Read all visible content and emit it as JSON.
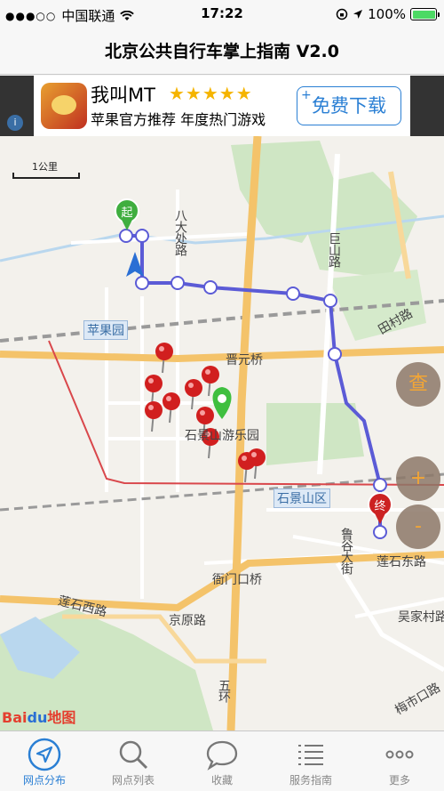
{
  "status_bar": {
    "carrier": "中国联通",
    "time": "17:22",
    "battery": "100%",
    "battery_level": 1.0
  },
  "nav": {
    "title": "北京公共自行车掌上指南 V2.0"
  },
  "ad": {
    "title": "我叫MT",
    "stars": "★★★★★",
    "rating": 5,
    "subtitle": "苹果官方推荐 年度热门游戏",
    "download_label": "免费下载"
  },
  "map": {
    "scale_label": "1公里",
    "start_marker": "起",
    "end_marker": "终",
    "query_button": "查",
    "zoom_in_button": "+",
    "zoom_out_button": "-",
    "labels": {
      "badachu": "八大处路",
      "jushan": "巨山路",
      "tianchun": "田村路",
      "pingguoyuan": "苹果园",
      "jinyuanqiao": "晋元桥",
      "youleyuan": "石景山游乐园",
      "shijingshan": "石景山区",
      "luguda": "鲁谷大街",
      "lianshidong": "莲石东路",
      "lianshixi": "莲石西路",
      "yamenkou": "衙门口桥",
      "jingyuan": "京原路",
      "wujiacun": "吴家村路",
      "wuhuan": "五环",
      "meishi": "梅市口路"
    },
    "brand": {
      "bai": "Bai",
      "du": "du",
      "suffix": "地图"
    }
  },
  "tabs": [
    {
      "label": "网点分布",
      "icon": "location-arrow-icon",
      "active": true
    },
    {
      "label": "网点列表",
      "icon": "search-icon",
      "active": false
    },
    {
      "label": "收藏",
      "icon": "chat-bubble-icon",
      "active": false
    },
    {
      "label": "服务指南",
      "icon": "list-icon",
      "active": false
    },
    {
      "label": "更多",
      "icon": "more-dots-icon",
      "active": false
    }
  ],
  "colors": {
    "route": "#5b5bd6",
    "active_tab": "#2a7fd4",
    "pin": "#d11f1f",
    "current_pin": "#3fbf3f",
    "highway": "#f4c36a"
  }
}
